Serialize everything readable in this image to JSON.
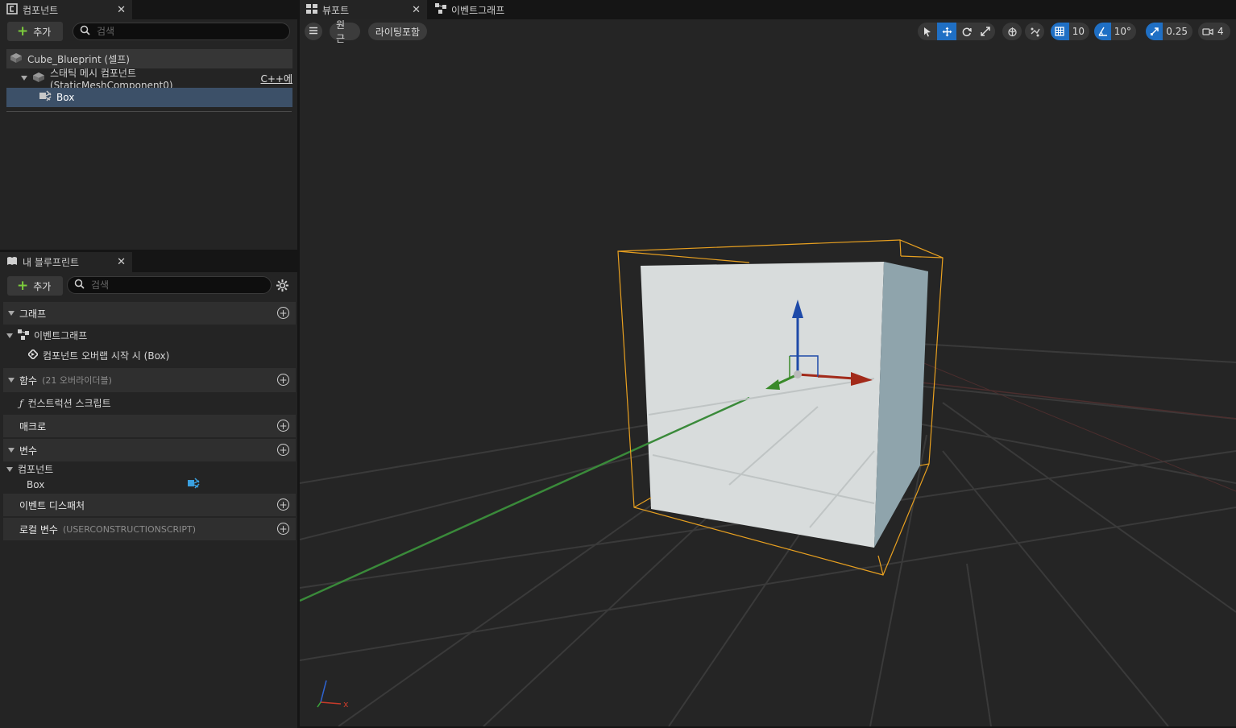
{
  "components_panel": {
    "tab_label": "컴포넌트",
    "add_label": "추가",
    "search_placeholder": "검색",
    "tree": {
      "root": "Cube_Blueprint (셀프)",
      "child": "스태틱 메시 컴포넌트 (StaticMeshComponent0)",
      "child_badge": "C++에",
      "grandchild": "Box"
    }
  },
  "blueprint_panel": {
    "tab_label": "내 블루프린트",
    "add_label": "추가",
    "search_placeholder": "검색",
    "sections": {
      "graphs": "그래프",
      "event_graph": "이벤트그래프",
      "event_node": "컴포넌트 오버랩 시작 시 (Box)",
      "functions": "함수",
      "functions_sub": "(21 오버라이더블)",
      "construction_script": "컨스트럭션 스크립트",
      "macros": "매크로",
      "variables": "변수",
      "components_category": "컴포넌트",
      "box_var": "Box",
      "event_dispatchers": "이벤트 디스패처",
      "local_vars": "로컬 변수",
      "local_vars_sub": "(USERCONSTRUCTIONSCRIPT)"
    }
  },
  "viewport": {
    "tab_label": "뷰포트",
    "event_graph_tab": "이벤트그래프",
    "perspective_label": "원근",
    "lighting_label": "라이팅포함",
    "grid_snap": "10",
    "rotation_snap": "10°",
    "scale_snap": "0.25",
    "camera_speed": "4",
    "axis_x_label": "x"
  },
  "colors": {
    "accent_blue": "#1f6fc4",
    "selection": "#3c5068",
    "add_green": "#7ccc3c",
    "bounds_orange": "#e8a020"
  }
}
